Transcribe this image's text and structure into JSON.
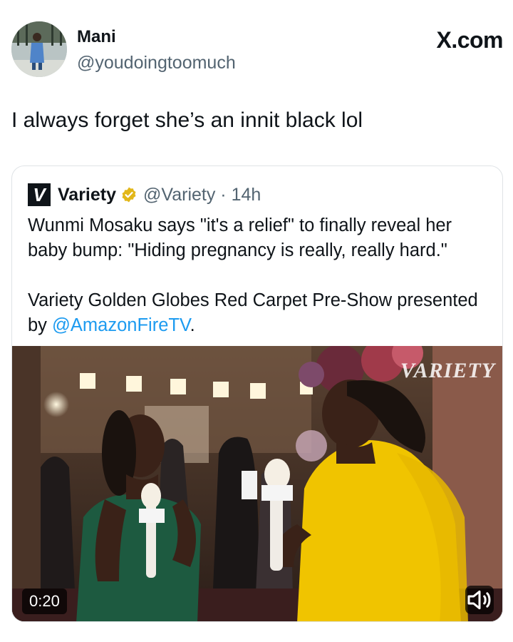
{
  "watermark": "X.com",
  "author": {
    "display_name": "Mani",
    "handle": "@youdoingtoomuch",
    "avatar_icon": "avatar-photo"
  },
  "tweet": {
    "text": "I always forget she’s an innit black lol"
  },
  "quoted_tweet": {
    "account_name": "Variety",
    "logo_letter": "V",
    "verified_color": "#e2b719",
    "handle_time": "@Variety · 14h",
    "paragraph1": "Wunmi Mosaku says \"it's a relief\" to finally reveal her baby bump: \"Hiding pregnancy is really, really hard.\"",
    "paragraph2_prefix": "Variety Golden Globes Red Carpet Pre-Show presented by ",
    "paragraph2_mention": "@AmazonFireTV",
    "paragraph2_suffix": ".",
    "video": {
      "duration": "0:20",
      "watermark": "VARIETY",
      "mute_icon": "speaker-icon"
    }
  },
  "colors": {
    "text": "#0f1419",
    "secondary": "#536471",
    "link": "#1d9bf0"
  }
}
